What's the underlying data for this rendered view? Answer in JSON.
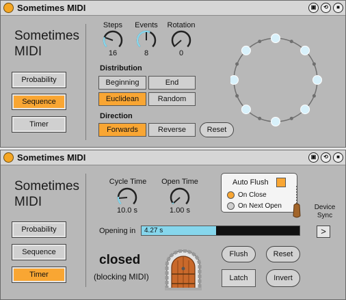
{
  "device1": {
    "title": "Sometimes MIDI",
    "big_title_line1": "Sometimes",
    "big_title_line2": "MIDI",
    "modes": [
      "Probability",
      "Sequence",
      "Timer"
    ],
    "active_mode": "Sequence",
    "knobs": [
      {
        "label": "Steps",
        "value": "16"
      },
      {
        "label": "Events",
        "value": "8"
      },
      {
        "label": "Rotation",
        "value": "0"
      }
    ],
    "distribution_label": "Distribution",
    "distribution_options": [
      "Beginning",
      "End",
      "Euclidean",
      "Random"
    ],
    "distribution_selected": "Euclidean",
    "direction_label": "Direction",
    "direction_options": [
      "Forwards",
      "Reverse"
    ],
    "direction_selected": "Forwards",
    "reset_label": "Reset",
    "steps_total": 16,
    "active_steps": [
      0,
      2,
      4,
      6,
      8,
      10,
      12,
      14
    ]
  },
  "device2": {
    "title": "Sometimes MIDI",
    "big_title_line1": "Sometimes",
    "big_title_line2": "MIDI",
    "modes": [
      "Probability",
      "Sequence",
      "Timer"
    ],
    "active_mode": "Timer",
    "knobs": [
      {
        "label": "Cycle Time",
        "value": "10.0 s"
      },
      {
        "label": "Open Time",
        "value": "1.00 s"
      }
    ],
    "auto_flush_label": "Auto Flush",
    "auto_flush_on": true,
    "radio_options": [
      "On Close",
      "On Next Open"
    ],
    "radio_selected": "On Close",
    "opening_label": "Opening in",
    "opening_value": "4.27 s",
    "opening_fraction": 0.47,
    "state_text": "closed",
    "state_sub": "(blocking MIDI)",
    "device_sync_line1": "Device",
    "device_sync_line2": "Sync",
    "device_sync_icon": ">",
    "buttons": [
      "Flush",
      "Reset",
      "Latch",
      "Invert"
    ]
  },
  "colors": {
    "accent": "#f9a633",
    "knob_arc": "#86d6ec",
    "step_on": "#d8f1fb",
    "panel_bg": "#b8b8b8"
  }
}
